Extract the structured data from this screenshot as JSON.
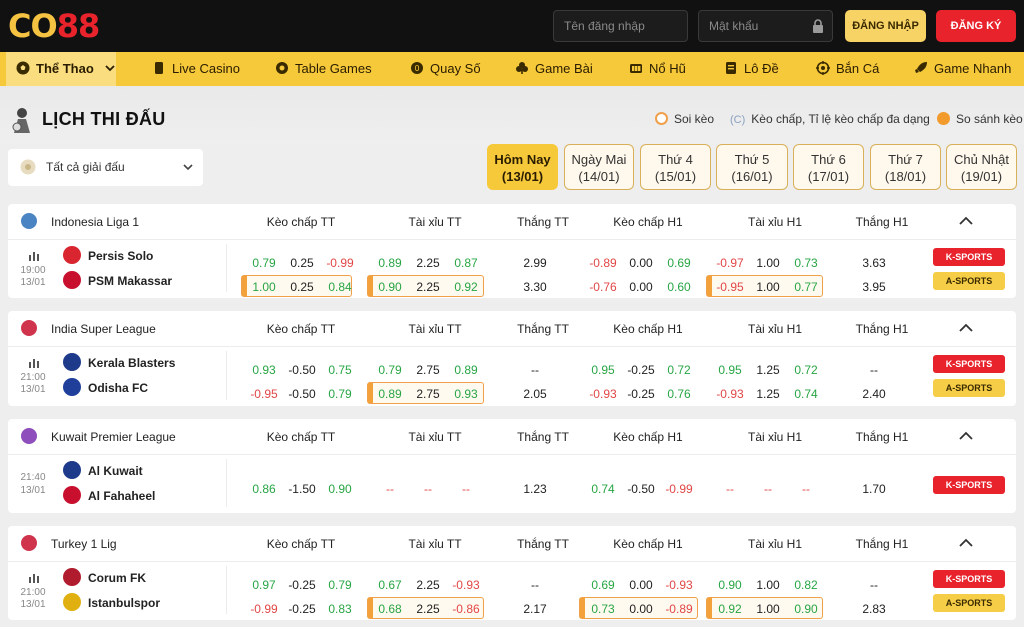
{
  "header": {
    "logo_co": "CO",
    "logo_88": "88",
    "username_placeholder": "Tên đăng nhập",
    "password_placeholder": "Mật khẩu",
    "login_label": "ĐĂNG NHẬP",
    "register_label": "ĐĂNG KÝ"
  },
  "nav": [
    {
      "label": "Thể Thao",
      "icon": "soccer-ball-icon"
    },
    {
      "label": "Live Casino",
      "icon": "card-icon"
    },
    {
      "label": "Table Games",
      "icon": "chip-icon"
    },
    {
      "label": "Quay Số",
      "icon": "coin-icon"
    },
    {
      "label": "Game Bài",
      "icon": "club-icon"
    },
    {
      "label": "Nổ Hũ",
      "icon": "slot-icon"
    },
    {
      "label": "Lô Đề",
      "icon": "lottery-icon"
    },
    {
      "label": "Bắn Cá",
      "icon": "target-icon"
    },
    {
      "label": "Game Nhanh",
      "icon": "rocket-icon"
    }
  ],
  "page": {
    "title": "LỊCH THI ĐẤU",
    "legend_soi_keo": "Soi kèo",
    "legend_keo_chap": "Kèo chấp, Tỉ lệ kèo chấp đa dạng",
    "legend_keo_chap_icon": "(C)",
    "legend_so_sanh": "So sánh kèo",
    "league_select": "Tất cả giải đấu"
  },
  "days": [
    {
      "name": "Hôm Nay",
      "date": "(13/01)"
    },
    {
      "name": "Ngày Mai",
      "date": "(14/01)"
    },
    {
      "name": "Thứ 4",
      "date": "(15/01)"
    },
    {
      "name": "Thứ 5",
      "date": "(16/01)"
    },
    {
      "name": "Thứ 6",
      "date": "(17/01)"
    },
    {
      "name": "Thứ 7",
      "date": "(18/01)"
    },
    {
      "name": "Chủ Nhật",
      "date": "(19/01)"
    }
  ],
  "columns": [
    "Kèo chấp TT",
    "Tài xỉu TT",
    "Thắng TT",
    "Kèo chấp H1",
    "Tài xỉu H1",
    "Thắng H1"
  ],
  "buttons": {
    "k": "K-SPORTS",
    "a": "A-SPORTS"
  },
  "leagues": [
    {
      "name": "Indonesia Liga 1",
      "time": "19:00",
      "date": "13/01",
      "teams": [
        "Persis Solo",
        "PSM Makassar"
      ],
      "rows": [
        [
          "0.79",
          "0.25",
          "-0.99",
          "0.89",
          "2.25",
          "0.87",
          "2.99",
          "-0.89",
          "0.00",
          "0.69",
          "-0.97",
          "1.00",
          "0.73",
          "3.63"
        ],
        [
          "1.00",
          "0.25",
          "0.84",
          "0.90",
          "2.25",
          "0.92",
          "3.30",
          "-0.76",
          "0.00",
          "0.60",
          "-0.95",
          "1.00",
          "0.77",
          "3.95"
        ]
      ]
    },
    {
      "name": "India Super League",
      "time": "21:00",
      "date": "13/01",
      "teams": [
        "Kerala Blasters",
        "Odisha FC"
      ],
      "rows": [
        [
          "0.93",
          "-0.50",
          "0.75",
          "0.79",
          "2.75",
          "0.89",
          "--",
          "0.95",
          "-0.25",
          "0.72",
          "0.95",
          "1.25",
          "0.72",
          "--"
        ],
        [
          "-0.95",
          "-0.50",
          "0.79",
          "0.89",
          "2.75",
          "0.93",
          "2.05",
          "-0.93",
          "-0.25",
          "0.76",
          "-0.93",
          "1.25",
          "0.74",
          "2.40"
        ]
      ]
    },
    {
      "name": "Kuwait Premier League",
      "time": "21:40",
      "date": "13/01",
      "teams": [
        "Al Kuwait",
        "Al Fahaheel"
      ],
      "rows": [
        [
          "0.86",
          "-1.50",
          "0.90",
          "--",
          "--",
          "--",
          "1.23",
          "0.74",
          "-0.50",
          "-0.99",
          "--",
          "--",
          "--",
          "1.70"
        ]
      ]
    },
    {
      "name": "Turkey 1 Lig",
      "time": "21:00",
      "date": "13/01",
      "teams": [
        "Corum FK",
        "Istanbulspor"
      ],
      "rows": [
        [
          "0.97",
          "-0.25",
          "0.79",
          "0.67",
          "2.25",
          "-0.93",
          "--",
          "0.69",
          "0.00",
          "-0.93",
          "0.90",
          "1.00",
          "0.82",
          "--"
        ],
        [
          "-0.99",
          "-0.25",
          "0.83",
          "0.68",
          "2.25",
          "-0.86",
          "2.17",
          "0.73",
          "0.00",
          "-0.89",
          "0.92",
          "1.00",
          "0.90",
          "2.83"
        ]
      ]
    }
  ],
  "colors": {
    "accent": "#f6c93a",
    "red": "#e8232c",
    "green": "#27a544",
    "negative": "#e14646"
  }
}
